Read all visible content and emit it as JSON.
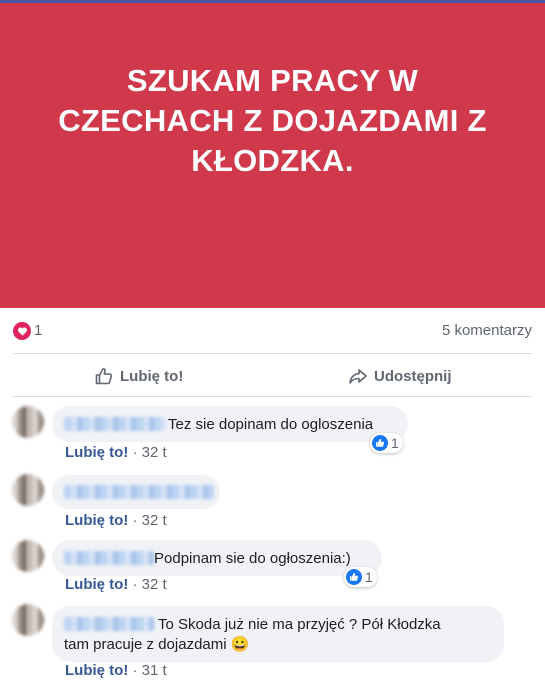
{
  "post": {
    "banner_text": "SZUKAM PRACY W CZECHACH Z DOJAZDAMI Z KŁODZKA.",
    "banner_color": "#d0384c",
    "reaction_icon": "heart-icon",
    "reaction_count": "1",
    "comments_count": "5 komentarzy"
  },
  "actions": {
    "like_label": "Lubię to!",
    "like_icon": "thumbs-up-outline-icon",
    "share_label": "Udostępnij",
    "share_icon": "share-arrow-icon"
  },
  "comments": [
    {
      "text": "Tez sie dopinam do ogloszenia",
      "text2": "",
      "like_link": "Lubię to!",
      "time": " · 32 t",
      "reactions": "1"
    },
    {
      "text": "",
      "text2": "",
      "like_link": "Lubię to!",
      "time": " · 32 t",
      "reactions": ""
    },
    {
      "text": "Podpinam sie do ogłoszenia:)",
      "text2": "",
      "like_link": "Lubię to!",
      "time": " · 32 t",
      "reactions": "1"
    },
    {
      "text": "To Skoda już nie ma przyjęć ? Pół Kłodzka",
      "text2": "tam pracuje z dojazdami 😀",
      "like_link": "Lubię to!",
      "time": " · 31 t",
      "reactions": ""
    }
  ]
}
